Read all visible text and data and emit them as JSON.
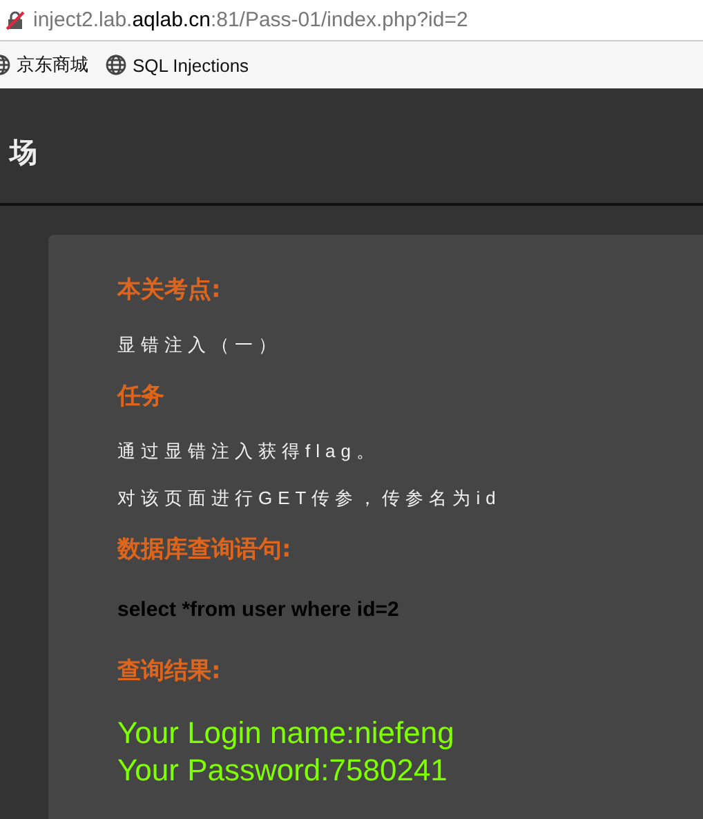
{
  "address_bar": {
    "url_parts": [
      {
        "text": "inject2.lab.",
        "kind": "dim"
      },
      {
        "text": "aqlab.cn",
        "kind": "domain"
      },
      {
        "text": ":81/Pass-01/index.php?id=2",
        "kind": "dim"
      }
    ]
  },
  "bookmarks": [
    {
      "label": "京东商城"
    },
    {
      "label": "SQL Injections"
    }
  ],
  "header": {
    "title": "场"
  },
  "content": [
    {
      "kind": "heading",
      "text": "本关考点:"
    },
    {
      "kind": "text",
      "text": "显错注入（一）"
    },
    {
      "kind": "heading",
      "text": "任务"
    },
    {
      "kind": "text",
      "text": "通过显错注入获得flag。"
    },
    {
      "kind": "text",
      "text": "对该页面进行GET传参，传参名为id"
    },
    {
      "kind": "heading",
      "text": "数据库查询语句:"
    },
    {
      "kind": "query",
      "text": "select *from user where id=2"
    },
    {
      "kind": "heading",
      "text": "查询结果:"
    },
    {
      "kind": "result",
      "text": "Your Login name:niefeng"
    },
    {
      "kind": "result",
      "text": "Your Password:7580241"
    }
  ]
}
